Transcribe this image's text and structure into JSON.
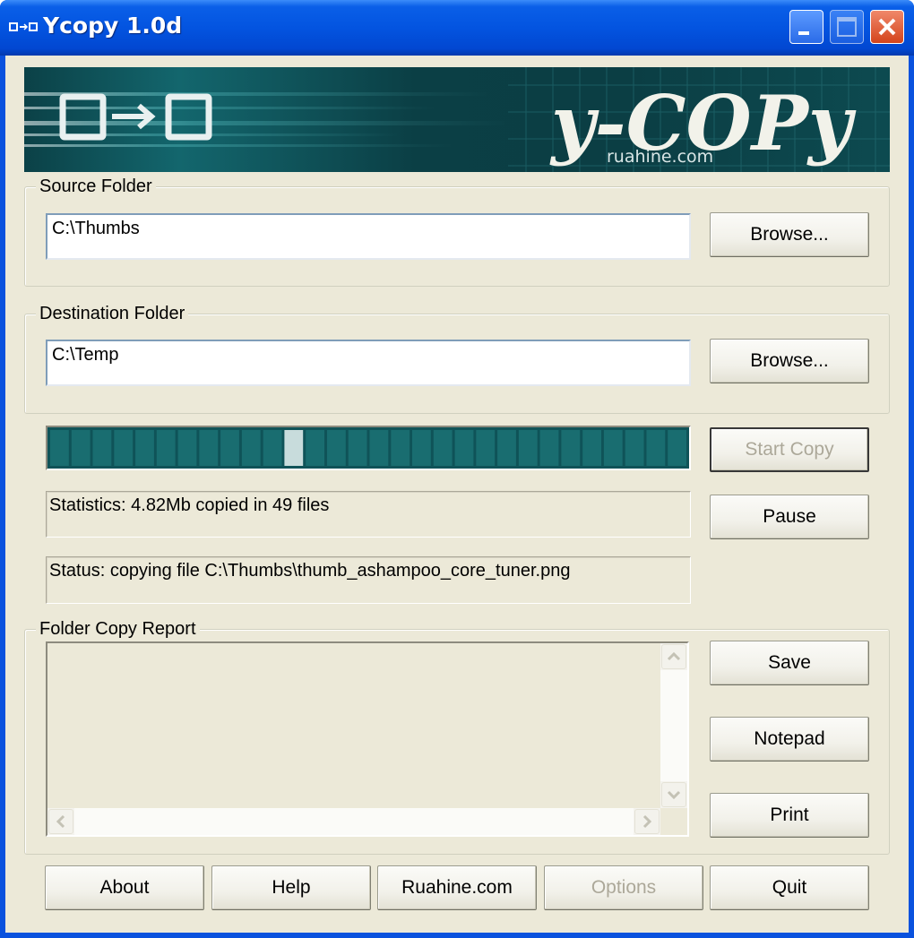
{
  "window": {
    "title": "Ycopy 1.0d",
    "icon": "arrow-copy-icon",
    "controls": [
      "minimize-icon",
      "maximize-icon",
      "close-icon"
    ]
  },
  "banner": {
    "logo_text": "y-COPy",
    "site_text": "ruahine.com",
    "icon": "copy-arrow-icon"
  },
  "source": {
    "label": "Source Folder",
    "value": "C:\\Thumbs",
    "browse_label": "Browse..."
  },
  "destination": {
    "label": "Destination Folder",
    "value": "C:\\Temp",
    "browse_label": "Browse..."
  },
  "progress": {
    "segments_total": 30,
    "highlighted_segment": 11
  },
  "actions": {
    "start_label": "Start Copy",
    "start_enabled": false,
    "pause_label": "Pause"
  },
  "statistics": {
    "text": "Statistics: 4.82Mb copied in 49 files"
  },
  "status": {
    "text": "Status: copying file C:\\Thumbs\\thumb_ashampoo_core_tuner.png"
  },
  "report": {
    "label": "Folder Copy Report",
    "save_label": "Save",
    "notepad_label": "Notepad",
    "print_label": "Print"
  },
  "footer": {
    "about_label": "About",
    "help_label": "Help",
    "ruahine_label": "Ruahine.com",
    "options_label": "Options",
    "options_enabled": false,
    "quit_label": "Quit"
  },
  "colors": {
    "titlebar": "#0a5fe8",
    "dialog_bg": "#ece9d8",
    "progress_bg": "#0f5358",
    "progress_segment": "#196d70",
    "progress_active": "#c8dcdc",
    "banner_bg": "#0b4147"
  }
}
